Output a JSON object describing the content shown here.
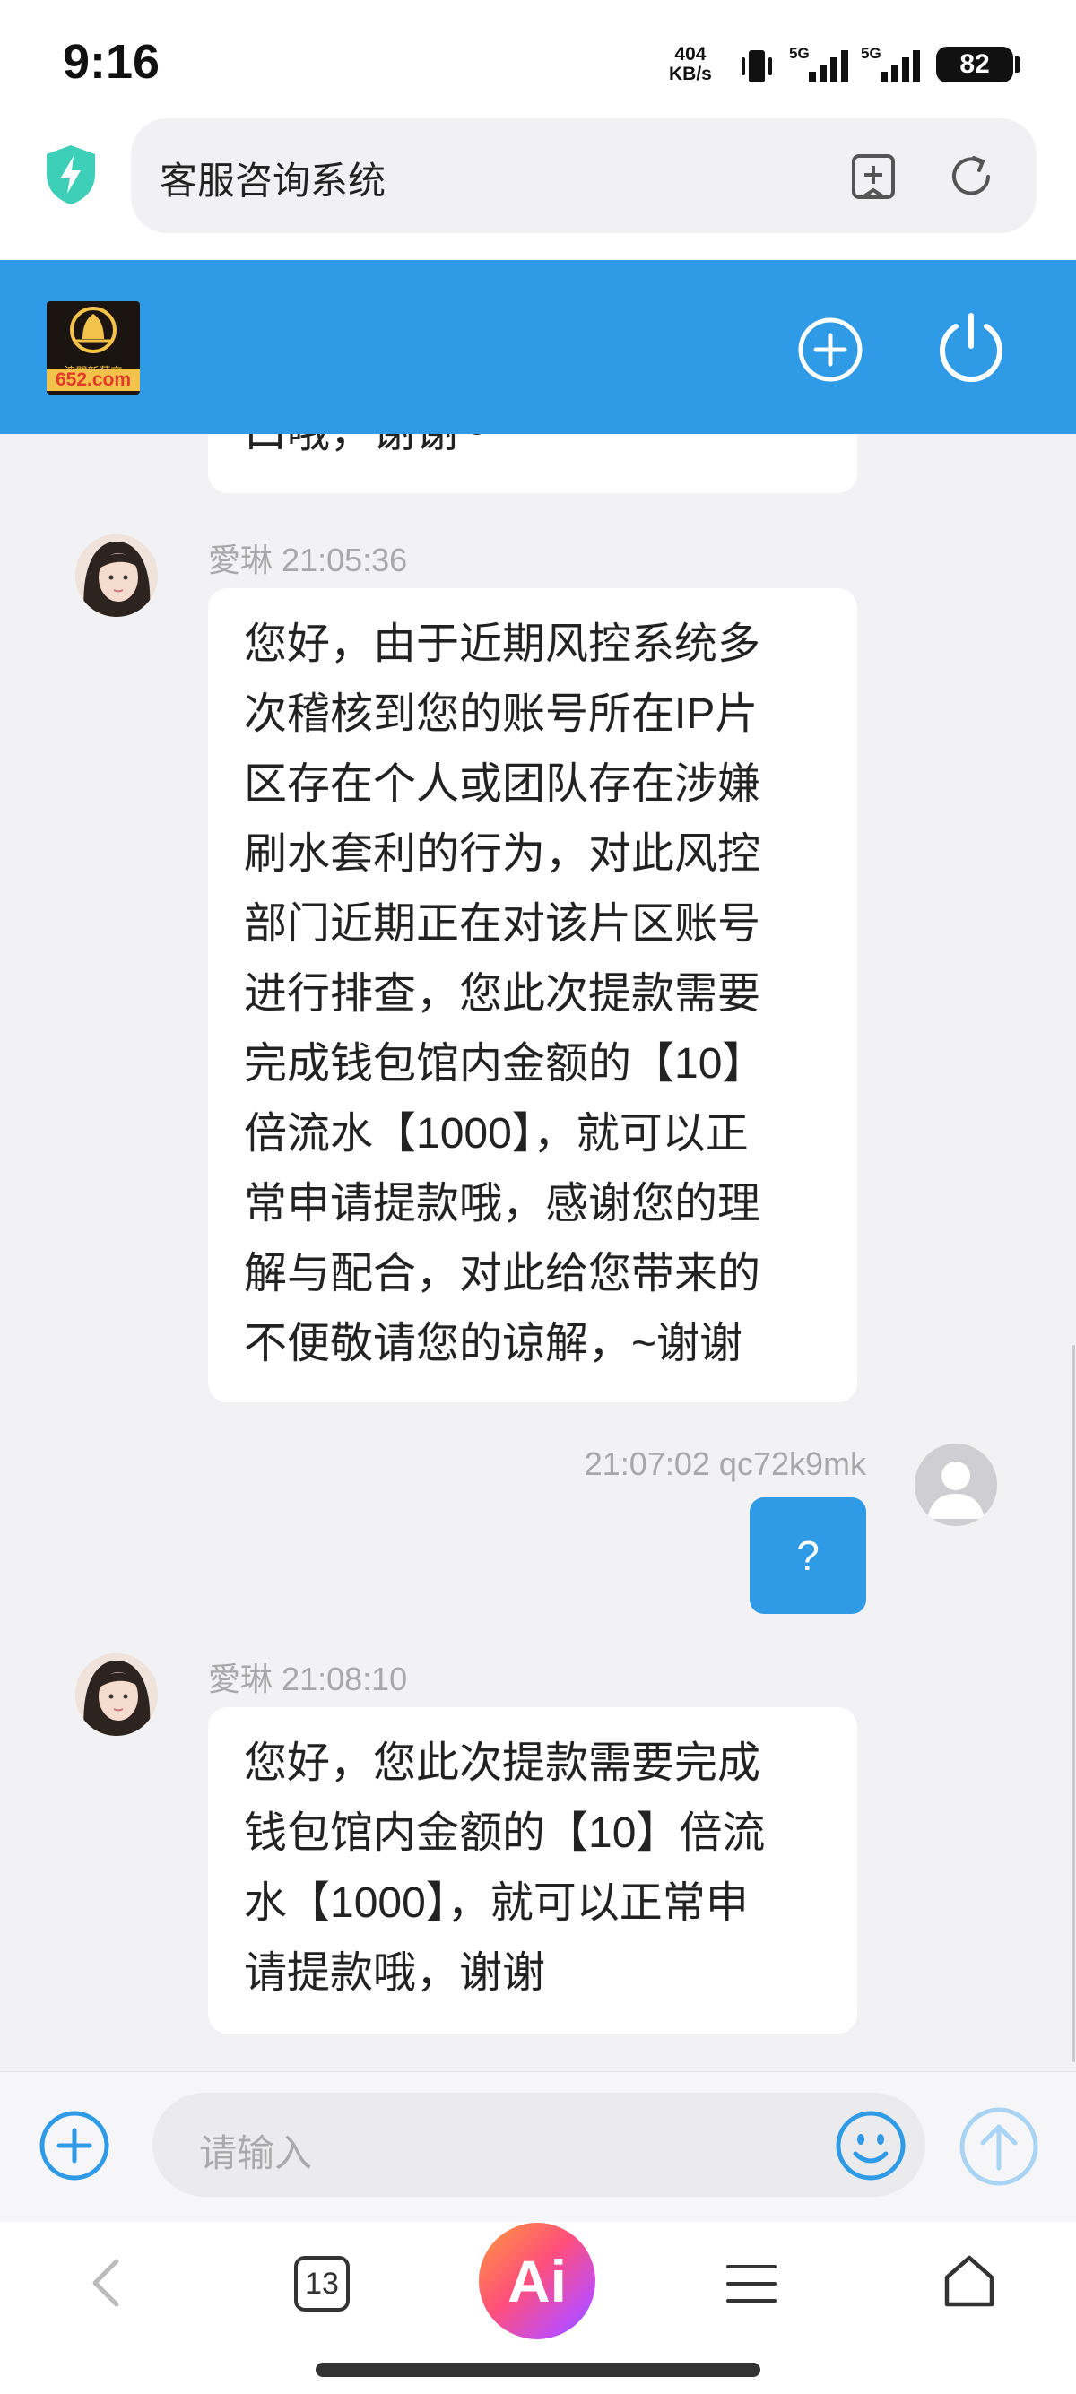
{
  "status_bar": {
    "time": "9:16",
    "net_speed_value": "404",
    "net_speed_unit": "KB/s",
    "signal1_label": "5G",
    "signal2_label": "5G",
    "battery": "82"
  },
  "browser": {
    "title": "客服咨询系统",
    "shield_icon": "shield-lightning-icon",
    "bookmark_icon": "bookmark-add-icon",
    "reload_icon": "reload-icon"
  },
  "header": {
    "logo_sub": "澳門新葡京",
    "logo_text": "652.com",
    "accent_color": "#2f9ae6"
  },
  "messages": [
    {
      "side": "left",
      "partial_text": "口哦，谢谢~"
    },
    {
      "side": "left",
      "sender": "愛琳",
      "time": "21:05:36",
      "lines": [
        "您好，由于近期风控系统多",
        "次稽核到您的账号所在IP片",
        "区存在个人或团队存在涉嫌",
        "刷水套利的行为，对此风控",
        "部门近期正在对该片区账号",
        "进行排查，您此次提款需要",
        "完成钱包馆内金额的【10】",
        "倍流水【1000】，就可以正",
        "常申请提款哦，感谢您的理",
        "解与配合，对此给您带来的",
        "不便敬请您的谅解，~谢谢"
      ]
    },
    {
      "side": "right",
      "time": "21:07:02",
      "sender": "qc72k9mk",
      "text": "?"
    },
    {
      "side": "left",
      "sender": "愛琳",
      "time": "21:08:10",
      "lines": [
        "您好，您此次提款需要完成",
        "钱包馆内金额的【10】倍流",
        "水【1000】，就可以正常申",
        "请提款哦，谢谢"
      ]
    }
  ],
  "input": {
    "placeholder": "请输入"
  },
  "bottom_nav": {
    "tab_count": "13",
    "ai_label": "Ai"
  }
}
